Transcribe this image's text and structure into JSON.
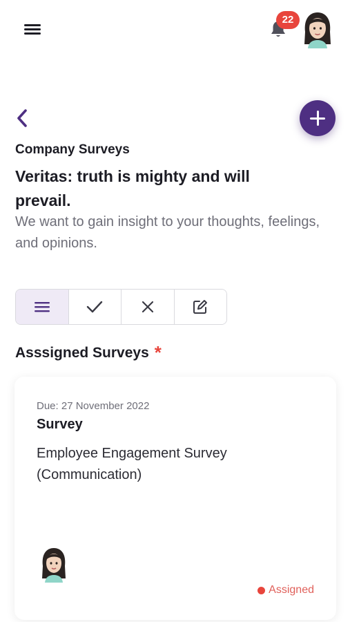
{
  "header": {
    "notification_count": "22",
    "menu_icon": "hamburger-menu-icon",
    "bell_icon": "bell-icon"
  },
  "nav": {
    "back_icon": "chevron-left-icon",
    "add_icon": "plus-icon"
  },
  "page": {
    "section": "Company Surveys",
    "title": "Veritas: truth is mighty and will prevail.",
    "subtitle": "We want to gain insight to your thoughts, feelings, and opinions."
  },
  "filters": [
    {
      "icon": "list-icon",
      "active": true
    },
    {
      "icon": "check-icon",
      "active": false
    },
    {
      "icon": "close-icon",
      "active": false
    },
    {
      "icon": "edit-icon",
      "active": false
    }
  ],
  "assigned": {
    "heading": "Asssigned Surveys",
    "required_mark": "*"
  },
  "survey_card": {
    "due": "Due: 27 November 2022",
    "type": "Survey",
    "name": "Employee Engagement Survey (Communication)",
    "status": "Assigned"
  },
  "colors": {
    "accent": "#4e2f82",
    "badge": "#e8453c",
    "status": "#e8453c"
  }
}
